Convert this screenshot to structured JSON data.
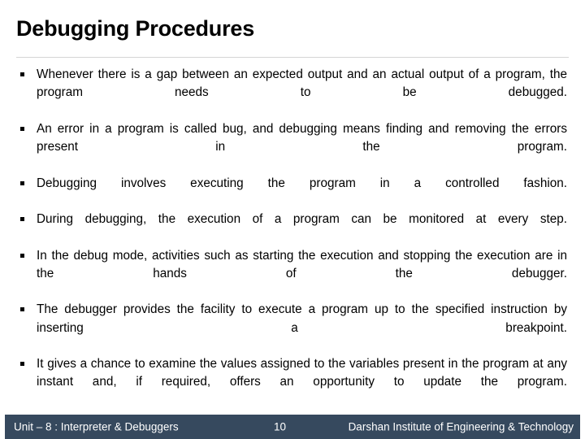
{
  "slide": {
    "title": "Debugging Procedures",
    "bullet_glyph": "square-bullet",
    "bullets": [
      "Whenever there is a gap between an expected output and an actual output of a program, the program needs to be debugged.",
      "An error in a program is called bug, and debugging means finding and removing the errors present in the program.",
      "Debugging involves executing the program in a controlled fashion.",
      "During debugging, the execution of a program can be monitored at every step.",
      "In the debug mode, activities such as starting the execution and stopping the execution are in the hands of the debugger.",
      "The debugger provides the facility to execute a program up to the specified instruction by inserting a breakpoint.",
      "It gives a chance to examine the values assigned to the variables present in the program at any instant and, if required, offers an opportunity to update the program."
    ]
  },
  "footer": {
    "unit": "Unit – 8 : Interpreter & Debuggers",
    "page_number": "10",
    "organization": "Darshan Institute of Engineering & Technology",
    "background_color": "#36495E",
    "text_color": "#FFFFFF"
  },
  "theme": {
    "title_color": "#000000",
    "body_color": "#000000",
    "rule_color": "#D4D4D4",
    "page_background": "#FFFFFF"
  }
}
